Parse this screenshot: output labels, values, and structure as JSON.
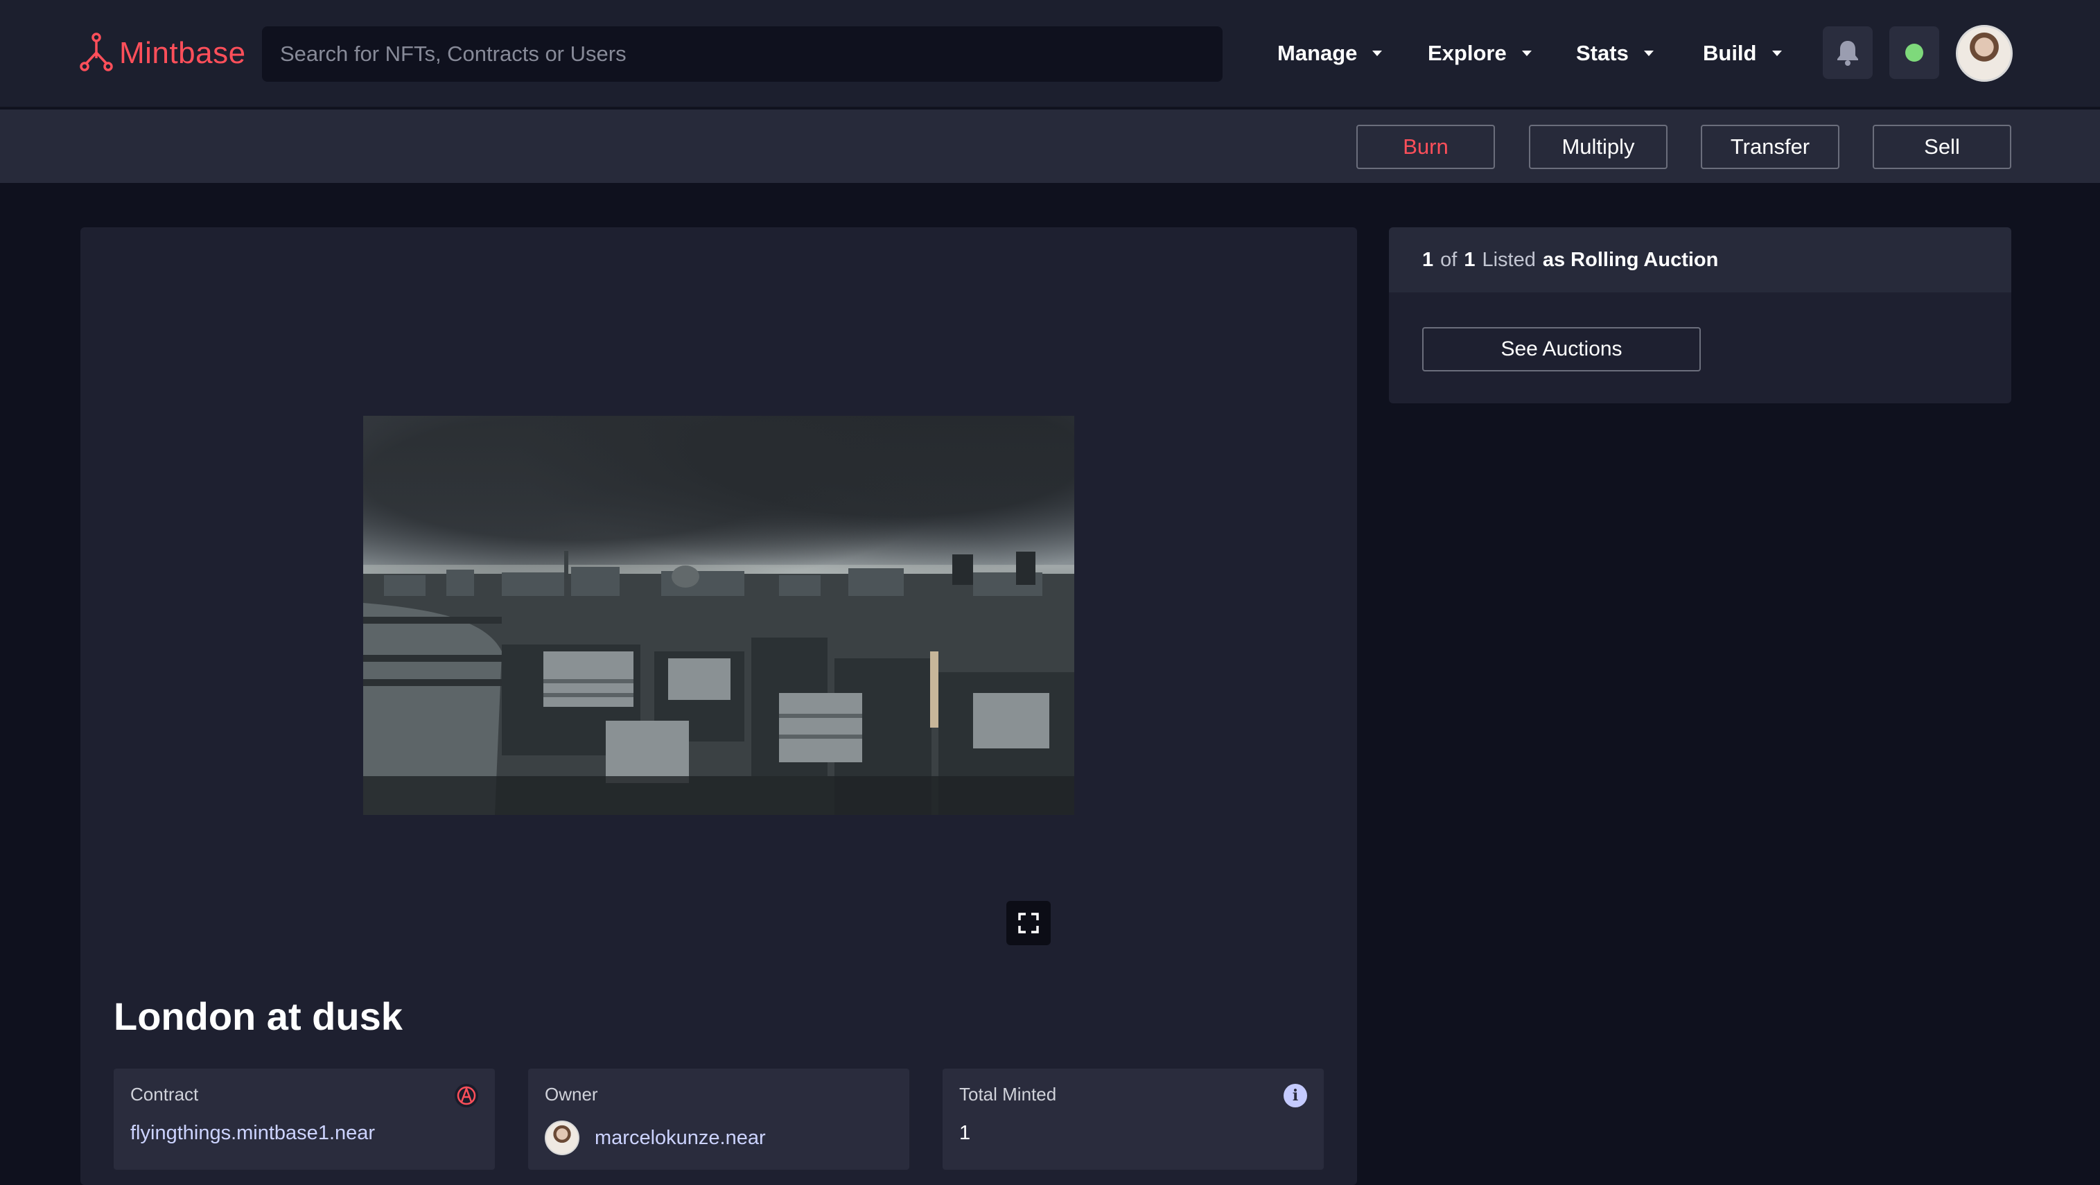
{
  "brand": {
    "name": "Mintbase",
    "color": "#ff4f5a"
  },
  "search": {
    "placeholder": "Search for NFTs, Contracts or Users"
  },
  "nav": {
    "items": [
      {
        "label": "Manage"
      },
      {
        "label": "Explore"
      },
      {
        "label": "Stats"
      },
      {
        "label": "Build"
      }
    ],
    "status_color": "#7ed97b"
  },
  "actions": {
    "burn": {
      "label": "Burn",
      "color": "#ff4f5a"
    },
    "multiply": {
      "label": "Multiply"
    },
    "transfer": {
      "label": "Transfer"
    },
    "sell": {
      "label": "Sell"
    }
  },
  "listing": {
    "count": "1",
    "of": "of",
    "total": "1",
    "listed": "Listed",
    "as_type": "as Rolling Auction",
    "button_label": "See Auctions"
  },
  "nft": {
    "title": "London at dusk",
    "image_icon": "london-skyline-photo",
    "contract": {
      "label": "Contract",
      "value": "flyingthings.mintbase1.near"
    },
    "owner": {
      "label": "Owner",
      "value": "marcelokunze.near"
    },
    "minted": {
      "label": "Total Minted",
      "value": "1"
    }
  }
}
